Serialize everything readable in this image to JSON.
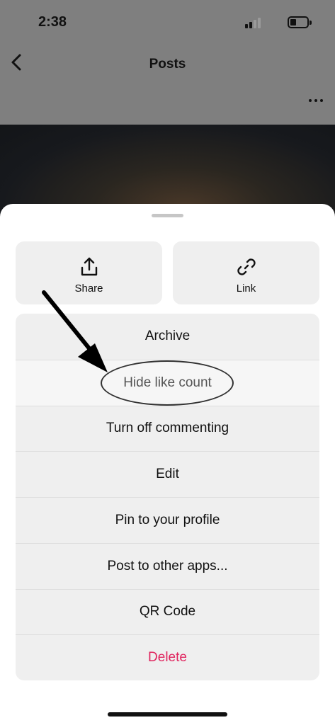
{
  "status_bar": {
    "time": "2:38",
    "battery_level": 0.35
  },
  "header": {
    "title": "Posts",
    "back_icon": "chevron-left-icon",
    "more_icon": "more-horizontal-icon"
  },
  "sheet": {
    "tiles": [
      {
        "label": "Share",
        "icon": "share-upload-icon"
      },
      {
        "label": "Link",
        "icon": "link-icon"
      }
    ],
    "options": [
      {
        "label": "Archive"
      },
      {
        "label": "Hide like count"
      },
      {
        "label": "Turn off commenting"
      },
      {
        "label": "Edit"
      },
      {
        "label": "Pin to your profile"
      },
      {
        "label": "Post to other apps..."
      },
      {
        "label": "QR Code"
      },
      {
        "label": "Delete",
        "color": "#e0245e"
      }
    ]
  },
  "annotation": {
    "target": "Hide like count"
  }
}
